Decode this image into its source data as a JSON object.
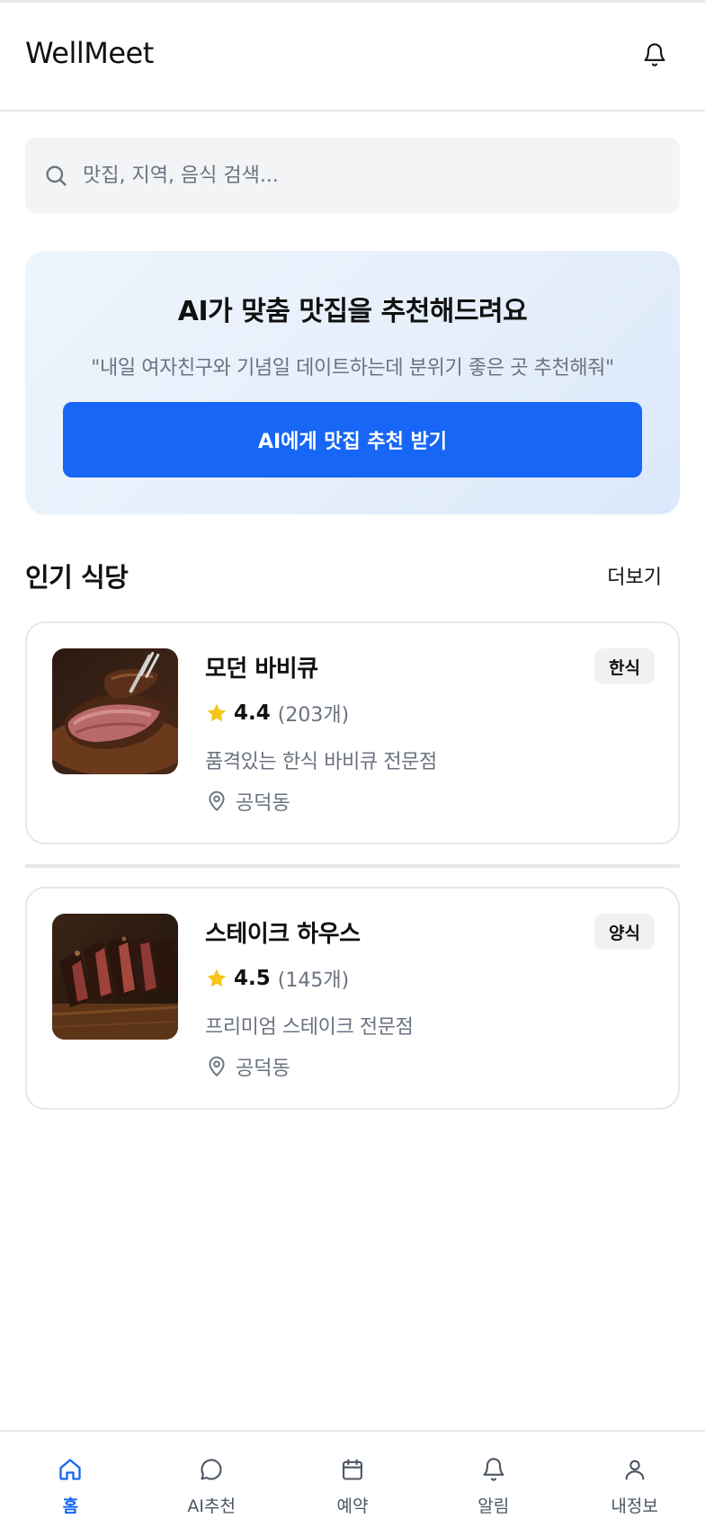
{
  "header": {
    "title": "WellMeet",
    "bell_icon": "bell-icon"
  },
  "search": {
    "placeholder": "맛집, 지역, 음식 검색...",
    "icon": "search-icon"
  },
  "ai_card": {
    "title": "AI가 맞춤 맛집을 추천해드려요",
    "example_quote": "\"내일 여자친구와 기념일 데이트하는데 분위기 좋은 곳 추천해줘\"",
    "button_label": "AI에게 맛집 추천 받기"
  },
  "popular": {
    "title": "인기 식당",
    "more_label": "더보기",
    "restaurants": [
      {
        "name": "모던 바비큐",
        "category": "한식",
        "rating": "4.4",
        "reviews": "(203개)",
        "description": "품격있는 한식 바비큐 전문점",
        "location": "공덕동"
      },
      {
        "name": "스테이크 하우스",
        "category": "양식",
        "rating": "4.5",
        "reviews": "(145개)",
        "description": "프리미엄 스테이크 전문점",
        "location": "공덕동"
      }
    ]
  },
  "bottom_nav": {
    "items": [
      {
        "label": "홈",
        "icon": "home-icon",
        "active": true
      },
      {
        "label": "AI추천",
        "icon": "chat-icon",
        "active": false
      },
      {
        "label": "예약",
        "icon": "calendar-icon",
        "active": false
      },
      {
        "label": "알림",
        "icon": "bell-icon",
        "active": false
      },
      {
        "label": "내정보",
        "icon": "user-icon",
        "active": false
      }
    ]
  },
  "colors": {
    "primary": "#1766f5",
    "star": "#f5c518",
    "muted_text": "#6b7280",
    "border": "#e5e7eb"
  }
}
